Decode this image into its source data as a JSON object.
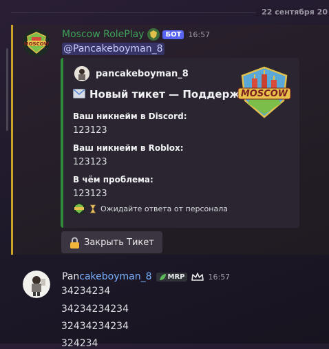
{
  "divider": {
    "date": "22 сентября 20"
  },
  "message1": {
    "author": "Moscow RolePlay",
    "bot_badge": "БОТ",
    "time": "16:57",
    "mention": "@Pancakeboyman_8",
    "embed": {
      "author_name": "pancakeboyman_8",
      "title": "Новый тикет — Поддержка",
      "title_icon": "envelope-icon",
      "fields": [
        {
          "name": "Ваш никнейм в Discord:",
          "value": "123123"
        },
        {
          "name": "Ваш никнейм в Roblox:",
          "value": "123123"
        },
        {
          "name": "В чём проблема:",
          "value": "123123"
        }
      ],
      "footer_text": "Ожидайте ответа от персонала",
      "footer_icon": "hourglass-icon",
      "accent_color": "#2f8a3a"
    },
    "button_label": "Закрыть Тикет",
    "button_icon": "lock-icon"
  },
  "message2": {
    "author_prefix": "Pan",
    "author_rest": "cakeboyman_8",
    "role_tag": "MRP",
    "time": "16:57",
    "lines": [
      "34234234",
      "34234234234",
      "32434234234",
      "324234"
    ]
  }
}
